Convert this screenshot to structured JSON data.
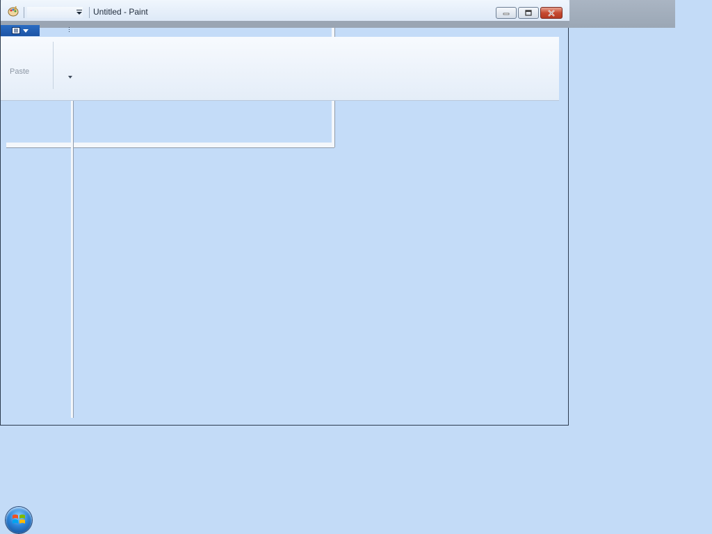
{
  "window": {
    "title": "Untitled - Paint"
  },
  "ribbon": {
    "paste_label": "Paste"
  },
  "icons": {
    "app": "paint-app-icon",
    "quick_access_dropdown": "chevron-down-icon",
    "minimize": "minimize-icon",
    "maximize": "maximize-icon",
    "close": "close-icon",
    "file_menu": "menu-icon",
    "start": "windows-start-orb-icon"
  },
  "colors": {
    "desktop": "#c3dbf7",
    "close_button": "#c64a31",
    "file_menu": "#1c54a5"
  }
}
